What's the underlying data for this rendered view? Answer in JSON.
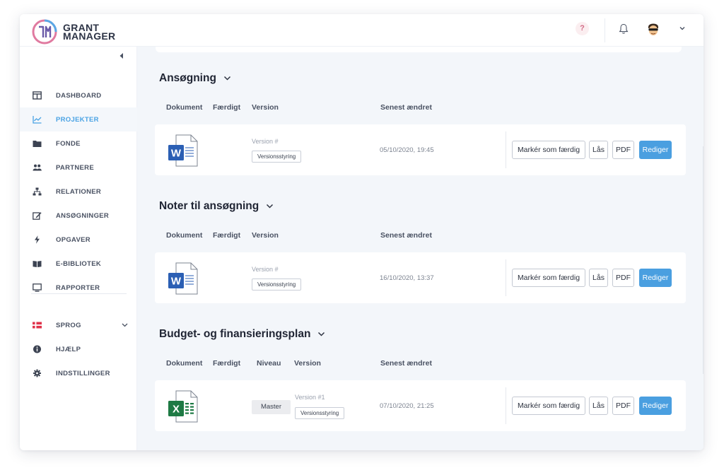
{
  "app": {
    "logo_line1": "GRANT",
    "logo_line2": "MANAGER"
  },
  "topbar": {
    "help_glyph": "?",
    "icons": [
      "help-icon",
      "bell-icon",
      "user-avatar",
      "chevron-down-icon"
    ]
  },
  "sidebar": {
    "items": [
      {
        "label": "DASHBOARD",
        "icon": "dashboard-icon",
        "active": false
      },
      {
        "label": "PROJEKTER",
        "icon": "chart-icon",
        "active": true
      },
      {
        "label": "FONDE",
        "icon": "folder-icon",
        "active": false
      },
      {
        "label": "PARTNERE",
        "icon": "users-icon",
        "active": false
      },
      {
        "label": "RELATIONER",
        "icon": "sitemap-icon",
        "active": false
      },
      {
        "label": "ANSØGNINGER",
        "icon": "edit-icon",
        "active": false
      },
      {
        "label": "OPGAVER",
        "icon": "bolt-icon",
        "active": false
      },
      {
        "label": "E-BIBLIOTEK",
        "icon": "book-icon",
        "active": false
      },
      {
        "label": "RAPPORTER",
        "icon": "monitor-icon",
        "active": false
      }
    ],
    "bottom_items": [
      {
        "label": "SPROG",
        "icon": "danish-flag-icon"
      },
      {
        "label": "HJÆLP",
        "icon": "info-icon"
      },
      {
        "label": "INDSTILLINGER",
        "icon": "cog-icon"
      }
    ]
  },
  "sections": [
    {
      "title": "Ansøgning",
      "headers": {
        "document": "Dokument",
        "done": "Færdigt",
        "version": "Version",
        "modified": "Senest ændret"
      },
      "row": {
        "file_type": "word",
        "version_label": "Version #",
        "version_button": "Versionsstyring",
        "modified": "05/10/2020, 19:45"
      }
    },
    {
      "title": "Noter til ansøgning",
      "headers": {
        "document": "Dokument",
        "done": "Færdigt",
        "version": "Version",
        "modified": "Senest ændret"
      },
      "row": {
        "file_type": "word",
        "version_label": "Version #",
        "version_button": "Versionsstyring",
        "modified": "16/10/2020, 13:37"
      }
    },
    {
      "title": "Budget- og finansieringsplan",
      "headers": {
        "document": "Dokument",
        "done": "Færdigt",
        "level": "Niveau",
        "version": "Version",
        "modified": "Senest ændret"
      },
      "row": {
        "file_type": "excel",
        "level": "Master",
        "version_label": "Version #1",
        "version_button": "Versionsstyring",
        "modified": "07/10/2020, 21:25"
      }
    }
  ],
  "actions": {
    "mark_done": "Markér som færdig",
    "lock": "Lås",
    "pdf": "PDF",
    "edit": "Rediger"
  },
  "colors": {
    "accent": "#4a9fe0",
    "active_nav": "#4aa3e4",
    "word": "#2b5fb4",
    "excel": "#1e7a44",
    "content_bg": "#f3f6fa"
  }
}
